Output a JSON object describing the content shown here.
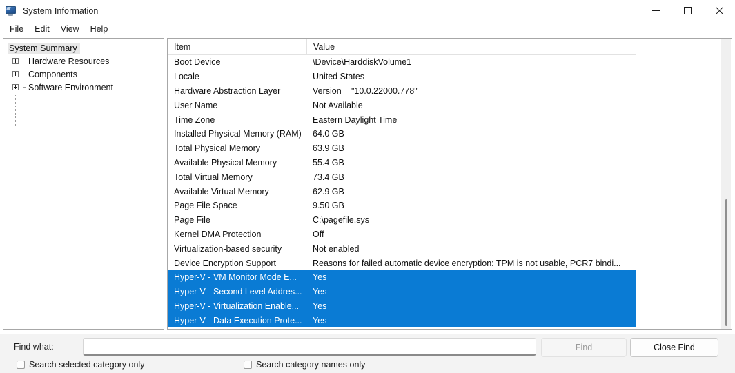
{
  "window": {
    "title": "System Information",
    "icon": "monitor-icon",
    "controls": {
      "minimize": "minimize-icon",
      "maximize": "maximize-icon",
      "close": "close-icon"
    }
  },
  "menubar": {
    "items": [
      {
        "label": "File"
      },
      {
        "label": "Edit"
      },
      {
        "label": "View"
      },
      {
        "label": "Help"
      }
    ]
  },
  "tree": {
    "root": {
      "label": "System Summary",
      "selected": true
    },
    "children": [
      {
        "label": "Hardware Resources",
        "expanded": false
      },
      {
        "label": "Components",
        "expanded": false
      },
      {
        "label": "Software Environment",
        "expanded": false
      }
    ]
  },
  "list": {
    "columns": [
      {
        "key": "item",
        "label": "Item"
      },
      {
        "key": "value",
        "label": "Value"
      }
    ],
    "rows": [
      {
        "item": "Boot Device",
        "value": "\\Device\\HarddiskVolume1",
        "selected": false
      },
      {
        "item": "Locale",
        "value": "United States",
        "selected": false
      },
      {
        "item": "Hardware Abstraction Layer",
        "value": "Version = \"10.0.22000.778\"",
        "selected": false
      },
      {
        "item": "User Name",
        "value": "Not Available",
        "selected": false
      },
      {
        "item": "Time Zone",
        "value": "Eastern Daylight Time",
        "selected": false
      },
      {
        "item": "Installed Physical Memory (RAM)",
        "value": "64.0 GB",
        "selected": false
      },
      {
        "item": "Total Physical Memory",
        "value": "63.9 GB",
        "selected": false
      },
      {
        "item": "Available Physical Memory",
        "value": "55.4 GB",
        "selected": false
      },
      {
        "item": "Total Virtual Memory",
        "value": "73.4 GB",
        "selected": false
      },
      {
        "item": "Available Virtual Memory",
        "value": "62.9 GB",
        "selected": false
      },
      {
        "item": "Page File Space",
        "value": "9.50 GB",
        "selected": false
      },
      {
        "item": "Page File",
        "value": "C:\\pagefile.sys",
        "selected": false
      },
      {
        "item": "Kernel DMA Protection",
        "value": "Off",
        "selected": false
      },
      {
        "item": "Virtualization-based security",
        "value": "Not enabled",
        "selected": false
      },
      {
        "item": "Device Encryption Support",
        "value": "Reasons for failed automatic device encryption: TPM is not usable, PCR7 bindi...",
        "selected": false
      },
      {
        "item": "Hyper-V - VM Monitor Mode E...",
        "value": "Yes",
        "selected": true
      },
      {
        "item": "Hyper-V - Second Level Addres...",
        "value": "Yes",
        "selected": true
      },
      {
        "item": "Hyper-V - Virtualization Enable...",
        "value": "Yes",
        "selected": true
      },
      {
        "item": "Hyper-V - Data Execution Prote...",
        "value": "Yes",
        "selected": true
      }
    ]
  },
  "findbar": {
    "label": "Find what:",
    "input_value": "",
    "input_placeholder": "",
    "find_button": "Find",
    "find_button_enabled": false,
    "close_button": "Close Find",
    "checkboxes": [
      {
        "label": "Search selected category only",
        "checked": false
      },
      {
        "label": "Search category names only",
        "checked": false
      }
    ]
  },
  "colors": {
    "selection_blue": "#0a7bd4",
    "panel_border": "#a7a7a7",
    "findbar_bg": "#f3f3f3"
  }
}
